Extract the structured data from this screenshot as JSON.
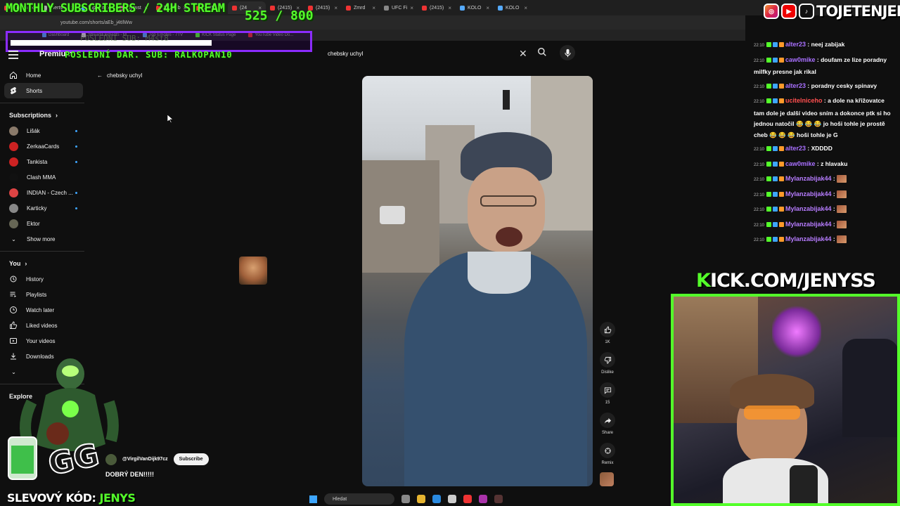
{
  "overlay": {
    "title": "MONTHLY SUBSCRIBERS / 24H STREAM",
    "count": "525  / 800",
    "last_sub_faded": "POSLEDNI SUB: M4st8",
    "last_donation_sub": "POSLEDNÍ DAR. SUB: RALKOPAN10",
    "kick_k": "K",
    "kick_rest": "ICK.COM/JENYSS",
    "social_handle": "TOJETENJENYS",
    "promo_label": "SLEVOVÝ KÓD:",
    "promo_code": "JENYS"
  },
  "browser": {
    "url": "youtube.com/shorts/aEb_j4tIlWw",
    "tabs": [
      {
        "label": "Stream",
        "color": "#e33"
      },
      {
        "label": "Alerts",
        "color": "#aaa"
      },
      {
        "label": "Top Em",
        "color": "#5af"
      },
      {
        "label": "(9) Inst",
        "color": "#d3a"
      },
      {
        "label": "YouTub",
        "color": "#e33"
      },
      {
        "label": "(2415)",
        "color": "#e33"
      },
      {
        "label": "(24",
        "color": "#e33"
      },
      {
        "label": "(2415)",
        "color": "#e33"
      },
      {
        "label": "(2415)",
        "color": "#e33"
      },
      {
        "label": "Zmrd",
        "color": "#e33"
      },
      {
        "label": "UFC Fi",
        "color": "#888"
      },
      {
        "label": "(2415)",
        "color": "#e33"
      },
      {
        "label": "KOLO",
        "color": "#5af"
      },
      {
        "label": "KOLO",
        "color": "#5af"
      }
    ],
    "bookmarks": [
      {
        "label": "Dashboard",
        "color": "#5af"
      },
      {
        "label": "StreamElements - M...",
        "color": "#ddd"
      },
      {
        "label": "Top Emotes - 7TV",
        "color": "#5af"
      },
      {
        "label": "KICK Status Page",
        "color": "#54ff2a"
      },
      {
        "label": "YouTube Video Do...",
        "color": "#e33"
      }
    ]
  },
  "youtube": {
    "premium_label": "Premium",
    "search_value": "chebsky uchyl",
    "back_title": "chebsky uchyl",
    "nav": [
      {
        "label": "Home",
        "icon": "home-icon"
      },
      {
        "label": "Shorts",
        "icon": "shorts-icon"
      }
    ],
    "subscriptions_title": "Subscriptions",
    "subscriptions": [
      {
        "label": "Lišák",
        "color": "#8a7a6a"
      },
      {
        "label": "ZerkaaCards",
        "color": "#c22"
      },
      {
        "label": "Tankista",
        "color": "#c22"
      },
      {
        "label": "Clash MMA",
        "color": "#111"
      },
      {
        "label": "INDIAN - Czech ...",
        "color": "#d44"
      },
      {
        "label": "Karticky",
        "color": "#888"
      },
      {
        "label": "Ektor",
        "color": "#665"
      }
    ],
    "show_more": "Show more",
    "you_title": "You",
    "you_items": [
      {
        "label": "History",
        "icon": "history-icon"
      },
      {
        "label": "Playlists",
        "icon": "playlists-icon"
      },
      {
        "label": "Watch later",
        "icon": "watch-later-icon"
      },
      {
        "label": "Liked videos",
        "icon": "liked-videos-icon"
      },
      {
        "label": "Your videos",
        "icon": "your-videos-icon"
      },
      {
        "label": "Downloads",
        "icon": "downloads-icon"
      }
    ],
    "explore_title": "Explore",
    "channel_name": "@VirgilVanDijk97cz",
    "subscribe_label": "Subscribe",
    "video_title": "DOBRÝ DEN!!!!!",
    "actions": [
      {
        "label": "1K",
        "icon": "like-icon"
      },
      {
        "label": "Dislike",
        "icon": "dislike-icon"
      },
      {
        "label": "15",
        "icon": "comments-icon"
      },
      {
        "label": "Share",
        "icon": "share-icon"
      },
      {
        "label": "Remix",
        "icon": "remix-icon"
      }
    ]
  },
  "chat": [
    {
      "ts": "22:10",
      "user": "alter23",
      "color": "#a970ff",
      "text": ": neej zabijak"
    },
    {
      "ts": "22:10",
      "user": "caw0mike",
      "color": "#a970ff",
      "text": ": doufam ze lize poradny milfky presne jak rikal"
    },
    {
      "ts": "22:10",
      "user": "alter23",
      "color": "#a970ff",
      "text": ": poradny cesky spinavy"
    },
    {
      "ts": "22:10",
      "user": "ucitelniceho",
      "color": "#ff4f4f",
      "text": ": a dole na křižovatce tam dole je další video sním a dokonce ptk si ho jednou natočil 😂 😂 😂 jo hoši tohle je prostě cheb 😂 😂 😂 hoši tohle je G"
    },
    {
      "ts": "22:10",
      "user": "alter23",
      "color": "#a970ff",
      "text": ": XDDDD"
    },
    {
      "ts": "22:10",
      "user": "caw0mike",
      "color": "#a970ff",
      "text": ": z hlavaku"
    },
    {
      "ts": "22:10",
      "user": "Mylanzabijak44",
      "color": "#b77cff",
      "text": ":"
    },
    {
      "ts": "22:10",
      "user": "Mylanzabijak44",
      "color": "#b77cff",
      "text": ":"
    },
    {
      "ts": "22:10",
      "user": "Mylanzabijak44",
      "color": "#b77cff",
      "text": ":"
    },
    {
      "ts": "22:10",
      "user": "Mylanzabijak44",
      "color": "#b77cff",
      "text": ":"
    },
    {
      "ts": "22:10",
      "user": "Mylanzabijak44",
      "color": "#b77cff",
      "text": ":"
    }
  ],
  "taskbar": {
    "search_placeholder": "Hledat"
  },
  "colors": {
    "accent_green": "#54ff2a",
    "accent_purple": "#8b2cff",
    "yt_bg": "#0f0f0f"
  }
}
